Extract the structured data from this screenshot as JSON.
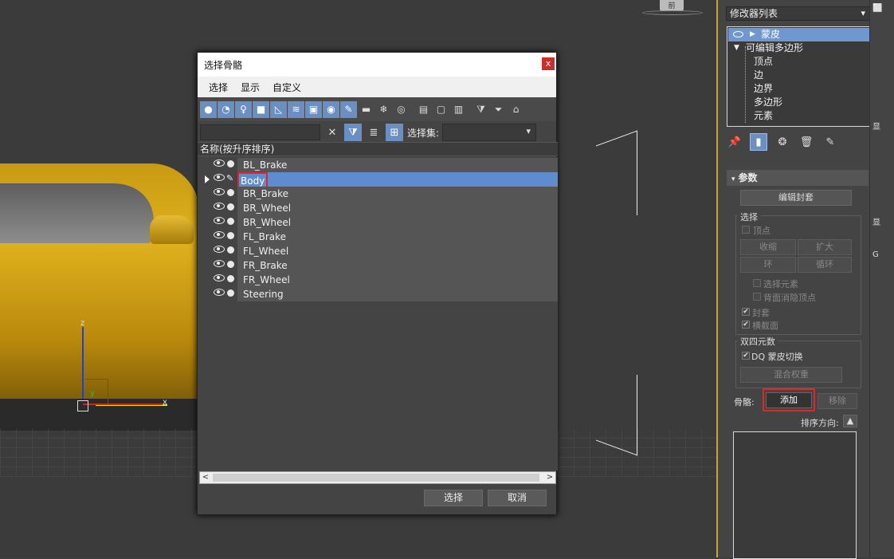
{
  "viewport": {
    "axis_z": "z",
    "axis_y": "y",
    "axis_x": "x",
    "viewcube_label": "前"
  },
  "dialog": {
    "title": "选择骨骼",
    "close": "x",
    "menu": [
      "选择",
      "显示",
      "自定义"
    ],
    "filter_selset_label": "选择集:",
    "list_header": "名称(按升序排序)",
    "rows": [
      {
        "name": "BL_Brake"
      },
      {
        "name": "Body"
      },
      {
        "name": "BR_Brake"
      },
      {
        "name": "BR_Wheel"
      },
      {
        "name": "BR_Wheel"
      },
      {
        "name": "FL_Brake"
      },
      {
        "name": "FL_Wheel"
      },
      {
        "name": "FR_Brake"
      },
      {
        "name": "FR_Wheel"
      },
      {
        "name": "Steering"
      }
    ],
    "select_button": "选择",
    "cancel_button": "取消",
    "scroll_left": "<",
    "scroll_right": ">"
  },
  "panel": {
    "modifier_list": "修改器列表",
    "stack": {
      "skin": "蒙皮",
      "editable_poly": "可编辑多边形",
      "subs": [
        "顶点",
        "边",
        "边界",
        "多边形",
        "元素"
      ]
    },
    "params_title": "参数",
    "edit_envelope": "编辑封套",
    "select_group": "选择",
    "vertex_chk": "顶点",
    "shrink": "收缩",
    "grow": "扩大",
    "ring": "环",
    "loop": "循环",
    "select_element": "选择元素",
    "backface_cull": "背面消隐顶点",
    "envelope": "封套",
    "cross_section": "横截面",
    "dq_group": "双四元数",
    "dq_toggle": "DQ 蒙皮切换",
    "blend_weight": "混合权重",
    "bones_label": "骨骼:",
    "add_button": "添加",
    "remove_button": "移除",
    "sort_dir": "排序方向:",
    "strip": [
      "显",
      "显",
      "G"
    ]
  },
  "colors": {
    "accent": "#6b8fc2",
    "highlight_red": "#e52525",
    "selection_row": "#5e8ccc",
    "panel_border": "#c8a81e"
  }
}
